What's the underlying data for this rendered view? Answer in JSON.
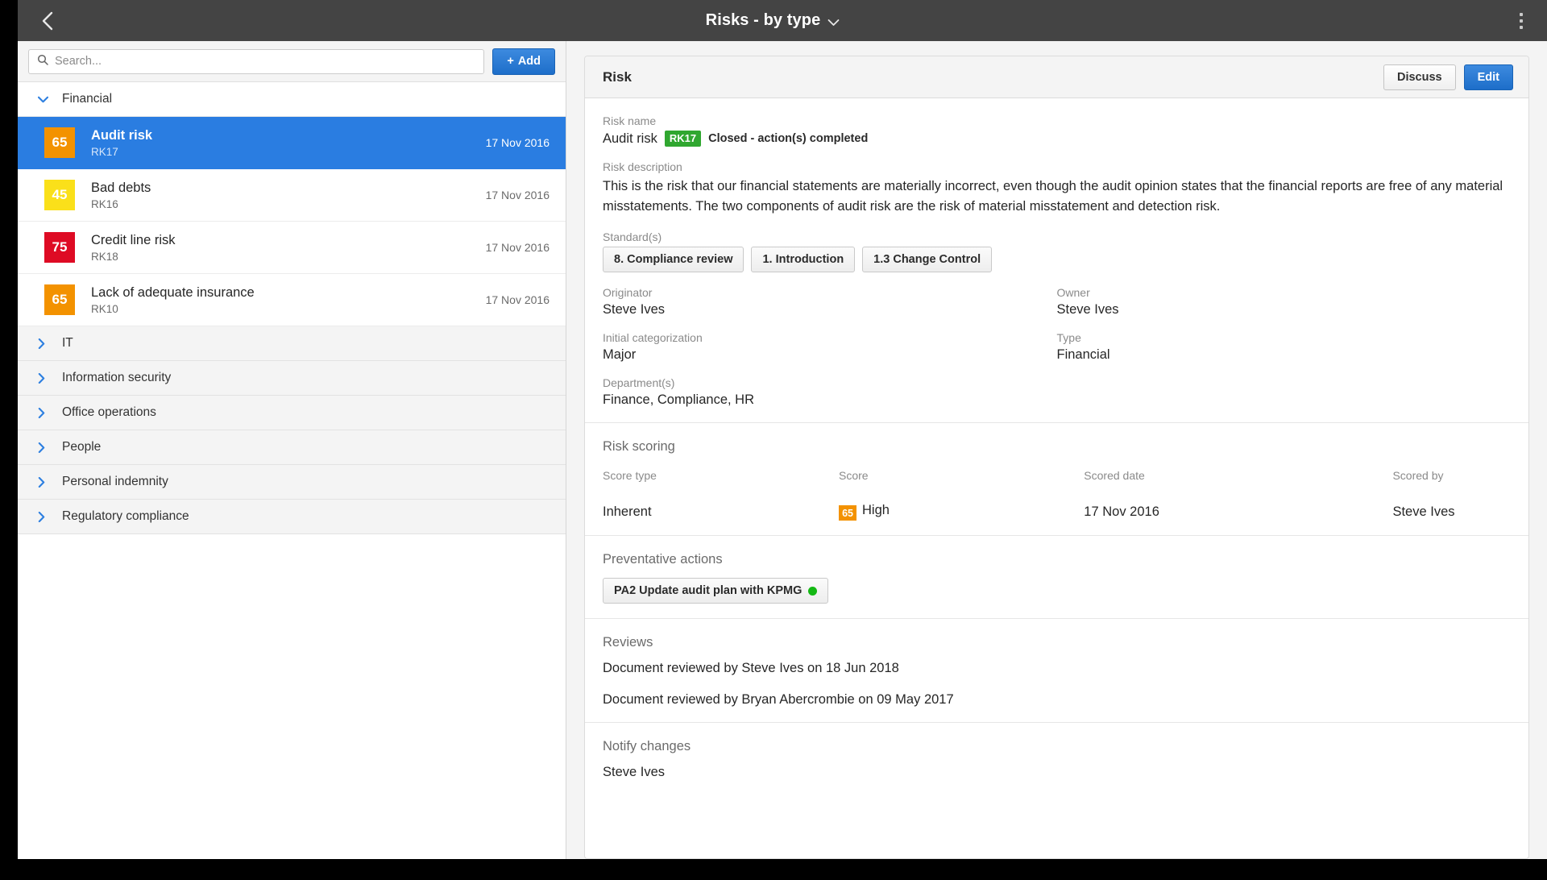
{
  "topbar": {
    "back_icon": "chevron-left-icon",
    "title": "Risks - by type",
    "dropdown_icon": "chevron-down-icon",
    "menu_icon": "kebab-menu-icon"
  },
  "sidebar": {
    "search": {
      "placeholder": "Search...",
      "value": "",
      "icon": "search-icon"
    },
    "add_button": {
      "label": "Add",
      "icon": "plus-icon"
    },
    "groups": [
      {
        "label": "Financial",
        "expanded": true,
        "items": [
          {
            "score": "65",
            "color": "#f39200",
            "name": "Audit risk",
            "code": "RK17",
            "date": "17 Nov 2016",
            "selected": true
          },
          {
            "score": "45",
            "color": "#fae01a",
            "name": "Bad debts",
            "code": "RK16",
            "date": "17 Nov 2016",
            "selected": false
          },
          {
            "score": "75",
            "color": "#de0b24",
            "name": "Credit line risk",
            "code": "RK18",
            "date": "17 Nov 2016",
            "selected": false
          },
          {
            "score": "65",
            "color": "#f39200",
            "name": "Lack of adequate insurance",
            "code": "RK10",
            "date": "17 Nov 2016",
            "selected": false
          }
        ]
      },
      {
        "label": "IT",
        "expanded": false,
        "items": []
      },
      {
        "label": "Information security",
        "expanded": false,
        "items": []
      },
      {
        "label": "Office operations",
        "expanded": false,
        "items": []
      },
      {
        "label": "People",
        "expanded": false,
        "items": []
      },
      {
        "label": "Personal indemnity",
        "expanded": false,
        "items": []
      },
      {
        "label": "Regulatory compliance",
        "expanded": false,
        "items": []
      }
    ]
  },
  "detail": {
    "header": {
      "title": "Risk",
      "discuss_label": "Discuss",
      "edit_label": "Edit"
    },
    "risk_name_label": "Risk name",
    "risk_name": "Audit risk",
    "risk_code_tag": "RK17",
    "risk_status": "Closed - action(s) completed",
    "risk_description_label": "Risk description",
    "risk_description": "This is the risk that our financial statements are materially incorrect, even though the audit opinion states that the financial reports are free of any material misstatements. The two components of audit risk are the risk of material misstatement and detection risk.",
    "standards_label": "Standard(s)",
    "standards": [
      "8. Compliance review",
      "1. Introduction",
      "1.3 Change Control"
    ],
    "fields": [
      {
        "label": "Originator",
        "value": "Steve Ives"
      },
      {
        "label": "Owner",
        "value": "Steve Ives"
      },
      {
        "label": "Initial categorization",
        "value": "Major"
      },
      {
        "label": "Type",
        "value": "Financial"
      },
      {
        "label": "Department(s)",
        "value": "Finance, Compliance, HR"
      }
    ],
    "scoring": {
      "title": "Risk scoring",
      "columns": [
        "Score type",
        "Score",
        "Scored date",
        "Scored by"
      ],
      "rows": [
        {
          "score_type": "Inherent",
          "score_value": "65",
          "score_color": "#f39200",
          "score_label": "High",
          "scored_date": "17 Nov 2016",
          "scored_by": "Steve Ives"
        }
      ]
    },
    "preventative": {
      "title": "Preventative actions",
      "items": [
        {
          "label": "PA2 Update audit plan with KPMG",
          "status_color": "#14b814"
        }
      ]
    },
    "reviews": {
      "title": "Reviews",
      "items": [
        "Document reviewed by Steve Ives on 18 Jun 2018",
        "Document reviewed by Bryan Abercrombie on 09 May 2017"
      ]
    },
    "notify": {
      "title": "Notify changes",
      "value": "Steve Ives"
    }
  }
}
